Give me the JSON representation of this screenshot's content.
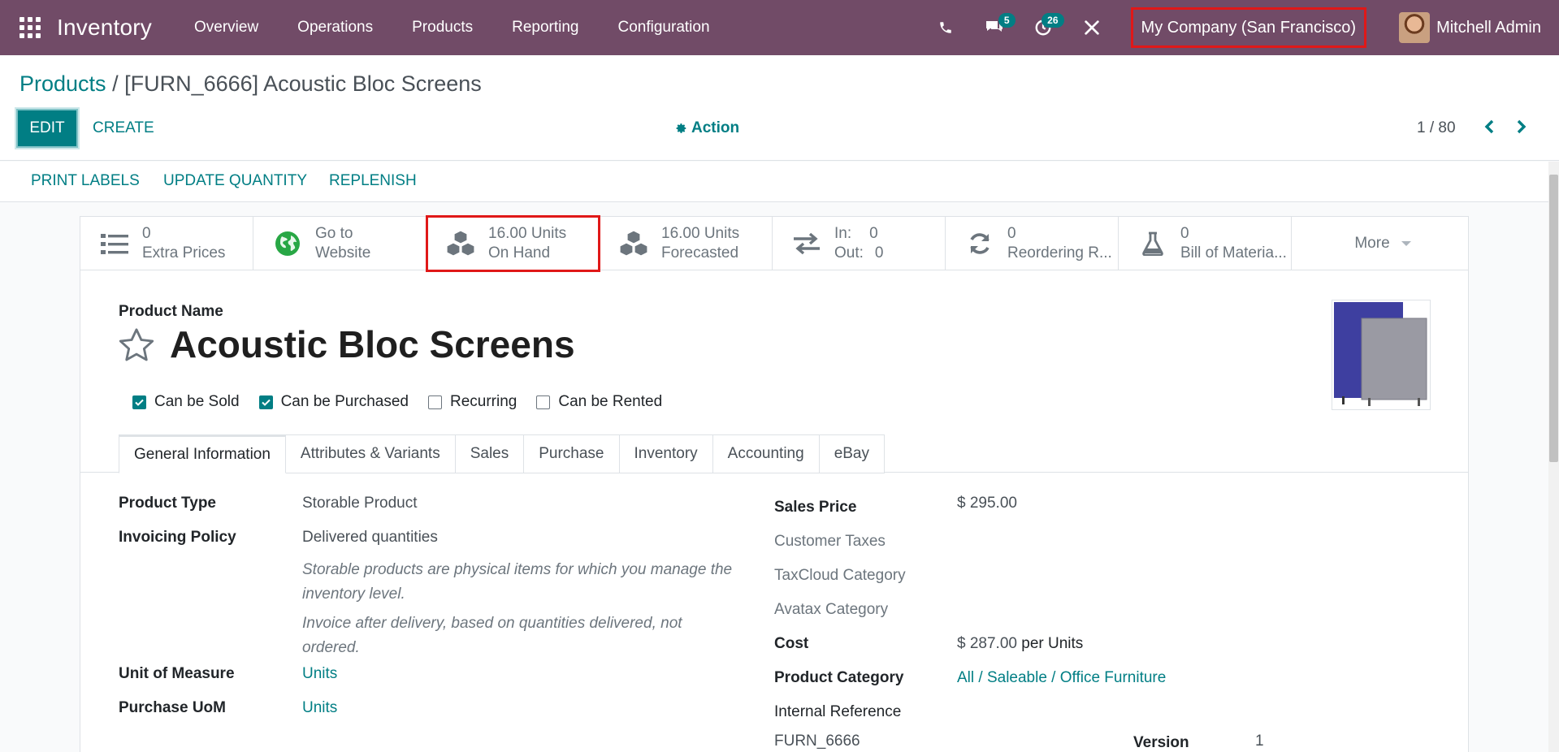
{
  "navbar": {
    "app_name": "Inventory",
    "menu": [
      "Overview",
      "Operations",
      "Products",
      "Reporting",
      "Configuration"
    ],
    "messages_count": "5",
    "activities_count": "26",
    "company": "My Company (San Francisco)",
    "user": "Mitchell Admin"
  },
  "breadcrumb": {
    "parent": "Products",
    "separator": " / ",
    "current": "[FURN_6666] Acoustic Bloc Screens"
  },
  "controls": {
    "edit": "EDIT",
    "create": "CREATE",
    "action": "Action",
    "pager": "1 / 80"
  },
  "statusbar": [
    "PRINT LABELS",
    "UPDATE QUANTITY",
    "REPLENISH"
  ],
  "smart_buttons": {
    "extra_prices": {
      "value": "0",
      "label": "Extra Prices"
    },
    "website": {
      "line1": "Go to",
      "line2": "Website"
    },
    "on_hand": {
      "value": "16.00 Units",
      "label": "On Hand"
    },
    "forecasted": {
      "value": "16.00 Units",
      "label": "Forecasted"
    },
    "in_out": {
      "in_label": "In:",
      "in_value": "0",
      "out_label": "Out:",
      "out_value": "0"
    },
    "reordering": {
      "value": "0",
      "label": "Reordering R..."
    },
    "bom": {
      "value": "0",
      "label": "Bill of Materia..."
    },
    "more": "More"
  },
  "product": {
    "name_label": "Product Name",
    "name": "Acoustic Bloc Screens",
    "checkboxes": [
      {
        "label": "Can be Sold",
        "checked": true
      },
      {
        "label": "Can be Purchased",
        "checked": true
      },
      {
        "label": "Recurring",
        "checked": false
      },
      {
        "label": "Can be Rented",
        "checked": false
      }
    ]
  },
  "tabs": [
    "General Information",
    "Attributes & Variants",
    "Sales",
    "Purchase",
    "Inventory",
    "Accounting",
    "eBay"
  ],
  "general": {
    "product_type_label": "Product Type",
    "product_type": "Storable Product",
    "invoicing_policy_label": "Invoicing Policy",
    "invoicing_policy": "Delivered quantities",
    "help_type": "Storable products are physical items for which you manage the inventory level.",
    "help_invoice": "Invoice after delivery, based on quantities delivered, not ordered.",
    "uom_label": "Unit of Measure",
    "uom": "Units",
    "purchase_uom_label": "Purchase UoM",
    "purchase_uom": "Units",
    "sales_price_label": "Sales Price",
    "sales_price": "$ 295.00",
    "customer_taxes_label": "Customer Taxes",
    "taxcloud_label": "TaxCloud Category",
    "avatax_label": "Avatax Category",
    "cost_label": "Cost",
    "cost": "$ 287.00",
    "cost_unit": "per Units",
    "category_label": "Product Category",
    "category": "All / Saleable / Office Furniture",
    "internal_ref_label": "Internal Reference",
    "internal_ref": "FURN_6666",
    "version_label": "Version",
    "version": "1"
  },
  "colors": {
    "navbar": "#714b67",
    "accent": "#017e84",
    "highlight": "#e01818"
  }
}
